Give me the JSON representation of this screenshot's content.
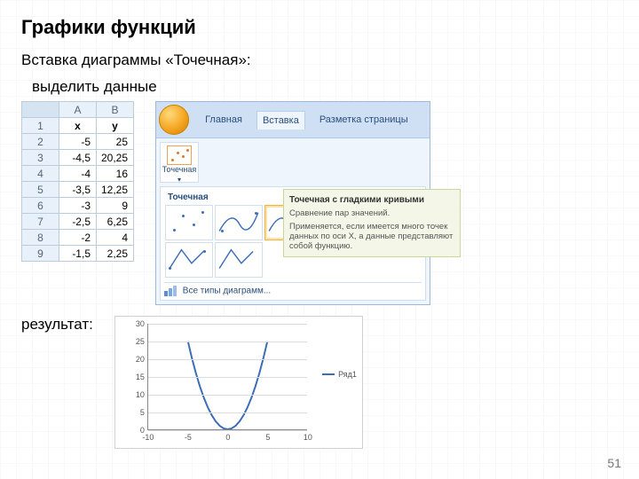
{
  "page": {
    "title": "Графики функций",
    "number": "51"
  },
  "line1": "Вставка диаграммы «Точечная»:",
  "line2": "выделить данные",
  "line3": "результат:",
  "sheet": {
    "cols": [
      "A",
      "B"
    ],
    "headers": [
      "x",
      "y"
    ],
    "rows": [
      {
        "n": "1",
        "a": "x",
        "b": "y",
        "head": true
      },
      {
        "n": "2",
        "a": "-5",
        "b": "25"
      },
      {
        "n": "3",
        "a": "-4,5",
        "b": "20,25"
      },
      {
        "n": "4",
        "a": "-4",
        "b": "16"
      },
      {
        "n": "5",
        "a": "-3,5",
        "b": "12,25"
      },
      {
        "n": "6",
        "a": "-3",
        "b": "9"
      },
      {
        "n": "7",
        "a": "-2,5",
        "b": "6,25"
      },
      {
        "n": "8",
        "a": "-2",
        "b": "4"
      },
      {
        "n": "9",
        "a": "-1,5",
        "b": "2,25"
      }
    ]
  },
  "ribbon": {
    "tabs": [
      "Главная",
      "Вставка",
      "Разметка страницы"
    ],
    "active_tab": "Вставка",
    "scatter_btn": "Точечная",
    "gallery_title": "Точечная",
    "all_types": "Все типы диаграмм...",
    "tooltip_title": "Точечная с гладкими кривыми",
    "tooltip_sub": "Сравнение пар значений.",
    "tooltip_body": "Применяется, если имеется много точек данных по оси X, а данные представляют собой функцию."
  },
  "chart_data": {
    "type": "line",
    "title": "",
    "xlabel": "",
    "ylabel": "",
    "xlim": [
      -10,
      10
    ],
    "ylim": [
      0,
      30
    ],
    "yticks": [
      0,
      5,
      10,
      15,
      20,
      25,
      30
    ],
    "xticks": [
      -10,
      -5,
      0,
      5,
      10
    ],
    "series": [
      {
        "name": "Ряд1",
        "x": [
          -5,
          -4.5,
          -4,
          -3.5,
          -3,
          -2.5,
          -2,
          -1.5,
          -1,
          -0.5,
          0,
          0.5,
          1,
          1.5,
          2,
          2.5,
          3,
          3.5,
          4,
          4.5,
          5
        ],
        "y": [
          25,
          20.25,
          16,
          12.25,
          9,
          6.25,
          4,
          2.25,
          1,
          0.25,
          0,
          0.25,
          1,
          2.25,
          4,
          6.25,
          9,
          12.25,
          16,
          20.25,
          25
        ]
      }
    ]
  }
}
